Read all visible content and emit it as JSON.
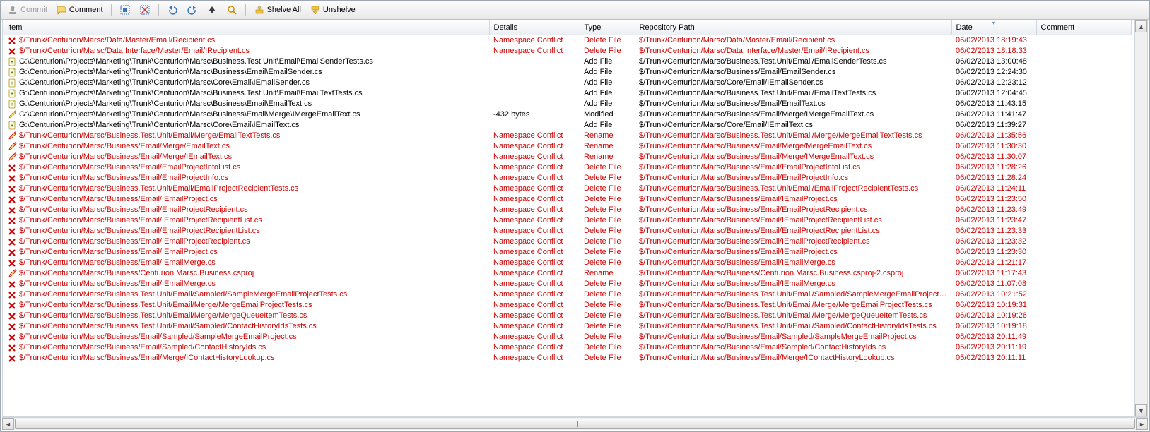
{
  "toolbar": {
    "commit": "Commit",
    "comment": "Comment",
    "shelve_all": "Shelve All",
    "unshelve": "Unshelve"
  },
  "columns": {
    "item": "Item",
    "details": "Details",
    "type": "Type",
    "repo": "Repository Path",
    "date": "Date",
    "comment": "Comment"
  },
  "rows": [
    {
      "conflict": true,
      "icon": "delete",
      "item": "$/Trunk/Centurion/Marsc/Data/Master/Email/Recipient.cs",
      "details": "Namespace Conflict",
      "type": "Delete File",
      "repo": "$/Trunk/Centurion/Marsc/Data/Master/Email/Recipient.cs",
      "date": "06/02/2013 18:19:43"
    },
    {
      "conflict": true,
      "icon": "delete",
      "item": "$/Trunk/Centurion/Marsc/Data.Interface/Master/Email/IRecipient.cs",
      "details": "Namespace Conflict",
      "type": "Delete File",
      "repo": "$/Trunk/Centurion/Marsc/Data.Interface/Master/Email/IRecipient.cs",
      "date": "06/02/2013 18:18:33"
    },
    {
      "conflict": false,
      "icon": "add",
      "item": "G:\\Centurion\\Projects\\Marketing\\Trunk\\Centurion\\Marsc\\Business.Test.Unit\\Email\\EmailSenderTests.cs",
      "details": "",
      "type": "Add File",
      "repo": "$/Trunk/Centurion/Marsc/Business.Test.Unit/Email/EmailSenderTests.cs",
      "date": "06/02/2013 13:00:48"
    },
    {
      "conflict": false,
      "icon": "add",
      "item": "G:\\Centurion\\Projects\\Marketing\\Trunk\\Centurion\\Marsc\\Business\\Email\\EmailSender.cs",
      "details": "",
      "type": "Add File",
      "repo": "$/Trunk/Centurion/Marsc/Business/Email/EmailSender.cs",
      "date": "06/02/2013 12:24:30"
    },
    {
      "conflict": false,
      "icon": "add",
      "item": "G:\\Centurion\\Projects\\Marketing\\Trunk\\Centurion\\Marsc\\Core\\Email\\IEmailSender.cs",
      "details": "",
      "type": "Add File",
      "repo": "$/Trunk/Centurion/Marsc/Core/Email/IEmailSender.cs",
      "date": "06/02/2013 12:23:12"
    },
    {
      "conflict": false,
      "icon": "add",
      "item": "G:\\Centurion\\Projects\\Marketing\\Trunk\\Centurion\\Marsc\\Business.Test.Unit\\Email\\EmailTextTests.cs",
      "details": "",
      "type": "Add File",
      "repo": "$/Trunk/Centurion/Marsc/Business.Test.Unit/Email/EmailTextTests.cs",
      "date": "06/02/2013 12:04:45"
    },
    {
      "conflict": false,
      "icon": "add",
      "item": "G:\\Centurion\\Projects\\Marketing\\Trunk\\Centurion\\Marsc\\Business\\Email\\EmailText.cs",
      "details": "",
      "type": "Add File",
      "repo": "$/Trunk/Centurion/Marsc/Business/Email/EmailText.cs",
      "date": "06/02/2013 11:43:15"
    },
    {
      "conflict": false,
      "icon": "edit",
      "item": "G:\\Centurion\\Projects\\Marketing\\Trunk\\Centurion\\Marsc\\Business\\Email\\Merge\\IMergeEmailText.cs",
      "details": "-432 bytes",
      "type": "Modified",
      "repo": "$/Trunk/Centurion/Marsc/Business/Email/Merge/IMergeEmailText.cs",
      "date": "06/02/2013 11:41:47"
    },
    {
      "conflict": false,
      "icon": "add",
      "item": "G:\\Centurion\\Projects\\Marketing\\Trunk\\Centurion\\Marsc\\Core\\Email\\IEmailText.cs",
      "details": "",
      "type": "Add File",
      "repo": "$/Trunk/Centurion/Marsc/Core/Email/IEmailText.cs",
      "date": "06/02/2013 11:39:27"
    },
    {
      "conflict": true,
      "icon": "edit",
      "item": "$/Trunk/Centurion/Marsc/Business.Test.Unit/Email/Merge/EmailTextTests.cs",
      "details": "Namespace Conflict",
      "type": "Rename",
      "repo": "$/Trunk/Centurion/Marsc/Business.Test.Unit/Email/Merge/MergeEmailTextTests.cs",
      "date": "06/02/2013 11:35:56"
    },
    {
      "conflict": true,
      "icon": "edit",
      "item": "$/Trunk/Centurion/Marsc/Business/Email/Merge/EmailText.cs",
      "details": "Namespace Conflict",
      "type": "Rename",
      "repo": "$/Trunk/Centurion/Marsc/Business/Email/Merge/MergeEmailText.cs",
      "date": "06/02/2013 11:30:30"
    },
    {
      "conflict": true,
      "icon": "edit",
      "item": "$/Trunk/Centurion/Marsc/Business/Email/Merge/IEmailText.cs",
      "details": "Namespace Conflict",
      "type": "Rename",
      "repo": "$/Trunk/Centurion/Marsc/Business/Email/Merge/IMergeEmailText.cs",
      "date": "06/02/2013 11:30:07"
    },
    {
      "conflict": true,
      "icon": "delete",
      "item": "$/Trunk/Centurion/Marsc/Business/Email/EmailProjectInfoList.cs",
      "details": "Namespace Conflict",
      "type": "Delete File",
      "repo": "$/Trunk/Centurion/Marsc/Business/Email/EmailProjectInfoList.cs",
      "date": "06/02/2013 11:28:26"
    },
    {
      "conflict": true,
      "icon": "delete",
      "item": "$/Trunk/Centurion/Marsc/Business/Email/EmailProjectInfo.cs",
      "details": "Namespace Conflict",
      "type": "Delete File",
      "repo": "$/Trunk/Centurion/Marsc/Business/Email/EmailProjectInfo.cs",
      "date": "06/02/2013 11:28:24"
    },
    {
      "conflict": true,
      "icon": "delete",
      "item": "$/Trunk/Centurion/Marsc/Business.Test.Unit/Email/EmailProjectRecipientTests.cs",
      "details": "Namespace Conflict",
      "type": "Delete File",
      "repo": "$/Trunk/Centurion/Marsc/Business.Test.Unit/Email/EmailProjectRecipientTests.cs",
      "date": "06/02/2013 11:24:11"
    },
    {
      "conflict": true,
      "icon": "delete",
      "item": "$/Trunk/Centurion/Marsc/Business/Email/IEmailProject.cs",
      "details": "Namespace Conflict",
      "type": "Delete File",
      "repo": "$/Trunk/Centurion/Marsc/Business/Email/IEmailProject.cs",
      "date": "06/02/2013 11:23:50"
    },
    {
      "conflict": true,
      "icon": "delete",
      "item": "$/Trunk/Centurion/Marsc/Business/Email/EmailProjectRecipient.cs",
      "details": "Namespace Conflict",
      "type": "Delete File",
      "repo": "$/Trunk/Centurion/Marsc/Business/Email/EmailProjectRecipient.cs",
      "date": "06/02/2013 11:23:49"
    },
    {
      "conflict": true,
      "icon": "delete",
      "item": "$/Trunk/Centurion/Marsc/Business/Email/IEmailProjectRecipientList.cs",
      "details": "Namespace Conflict",
      "type": "Delete File",
      "repo": "$/Trunk/Centurion/Marsc/Business/Email/IEmailProjectRecipientList.cs",
      "date": "06/02/2013 11:23:47"
    },
    {
      "conflict": true,
      "icon": "delete",
      "item": "$/Trunk/Centurion/Marsc/Business/Email/EmailProjectRecipientList.cs",
      "details": "Namespace Conflict",
      "type": "Delete File",
      "repo": "$/Trunk/Centurion/Marsc/Business/Email/EmailProjectRecipientList.cs",
      "date": "06/02/2013 11:23:33"
    },
    {
      "conflict": true,
      "icon": "delete",
      "item": "$/Trunk/Centurion/Marsc/Business/Email/IEmailProjectRecipient.cs",
      "details": "Namespace Conflict",
      "type": "Delete File",
      "repo": "$/Trunk/Centurion/Marsc/Business/Email/IEmailProjectRecipient.cs",
      "date": "06/02/2013 11:23:32"
    },
    {
      "conflict": true,
      "icon": "delete",
      "item": "$/Trunk/Centurion/Marsc/Business/Email/IEmailProject.cs",
      "details": "Namespace Conflict",
      "type": "Delete File",
      "repo": "$/Trunk/Centurion/Marsc/Business/Email/IEmailProject.cs",
      "date": "06/02/2013 11:23:30"
    },
    {
      "conflict": true,
      "icon": "delete",
      "item": "$/Trunk/Centurion/Marsc/Business/Email/IEmailMerge.cs",
      "details": "Namespace Conflict",
      "type": "Delete File",
      "repo": "$/Trunk/Centurion/Marsc/Business/Email/IEmailMerge.cs",
      "date": "06/02/2013 11:21:17"
    },
    {
      "conflict": true,
      "icon": "edit",
      "item": "$/Trunk/Centurion/Marsc/Business/Centurion.Marsc.Business.csproj",
      "details": "Namespace Conflict",
      "type": "Rename",
      "repo": "$/Trunk/Centurion/Marsc/Business/Centurion.Marsc.Business.csproj-2.csproj",
      "date": "06/02/2013 11:17:43"
    },
    {
      "conflict": true,
      "icon": "delete",
      "item": "$/Trunk/Centurion/Marsc/Business/Email/IEmailMerge.cs",
      "details": "Namespace Conflict",
      "type": "Delete File",
      "repo": "$/Trunk/Centurion/Marsc/Business/Email/IEmailMerge.cs",
      "date": "06/02/2013 11:07:08"
    },
    {
      "conflict": true,
      "icon": "delete",
      "item": "$/Trunk/Centurion/Marsc/Business.Test.Unit/Email/Sampled/SampleMergeEmailProjectTests.cs",
      "details": "Namespace Conflict",
      "type": "Delete File",
      "repo": "$/Trunk/Centurion/Marsc/Business.Test.Unit/Email/Sampled/SampleMergeEmailProjectTest...",
      "date": "06/02/2013 10:21:52"
    },
    {
      "conflict": true,
      "icon": "delete",
      "item": "$/Trunk/Centurion/Marsc/Business.Test.Unit/Email/Merge/MergeEmailProjectTests.cs",
      "details": "Namespace Conflict",
      "type": "Delete File",
      "repo": "$/Trunk/Centurion/Marsc/Business.Test.Unit/Email/Merge/MergeEmailProjectTests.cs",
      "date": "06/02/2013 10:19:31"
    },
    {
      "conflict": true,
      "icon": "delete",
      "item": "$/Trunk/Centurion/Marsc/Business.Test.Unit/Email/Merge/MergeQueueItemTests.cs",
      "details": "Namespace Conflict",
      "type": "Delete File",
      "repo": "$/Trunk/Centurion/Marsc/Business.Test.Unit/Email/Merge/MergeQueueItemTests.cs",
      "date": "06/02/2013 10:19:26"
    },
    {
      "conflict": true,
      "icon": "delete",
      "item": "$/Trunk/Centurion/Marsc/Business.Test.Unit/Email/Sampled/ContactHistoryIdsTests.cs",
      "details": "Namespace Conflict",
      "type": "Delete File",
      "repo": "$/Trunk/Centurion/Marsc/Business.Test.Unit/Email/Sampled/ContactHistoryIdsTests.cs",
      "date": "06/02/2013 10:19:18"
    },
    {
      "conflict": true,
      "icon": "delete",
      "item": "$/Trunk/Centurion/Marsc/Business/Email/Sampled/SampleMergeEmailProject.cs",
      "details": "Namespace Conflict",
      "type": "Delete File",
      "repo": "$/Trunk/Centurion/Marsc/Business/Email/Sampled/SampleMergeEmailProject.cs",
      "date": "05/02/2013 20:11:49"
    },
    {
      "conflict": true,
      "icon": "delete",
      "item": "$/Trunk/Centurion/Marsc/Business/Email/Sampled/ContactHistoryIds.cs",
      "details": "Namespace Conflict",
      "type": "Delete File",
      "repo": "$/Trunk/Centurion/Marsc/Business/Email/Sampled/ContactHistoryIds.cs",
      "date": "05/02/2013 20:11:19"
    },
    {
      "conflict": true,
      "icon": "delete",
      "item": "$/Trunk/Centurion/Marsc/Business/Email/Merge/IContactHistoryLookup.cs",
      "details": "Namespace Conflict",
      "type": "Delete File",
      "repo": "$/Trunk/Centurion/Marsc/Business/Email/Merge/IContactHistoryLookup.cs",
      "date": "05/02/2013 20:11:11"
    }
  ]
}
